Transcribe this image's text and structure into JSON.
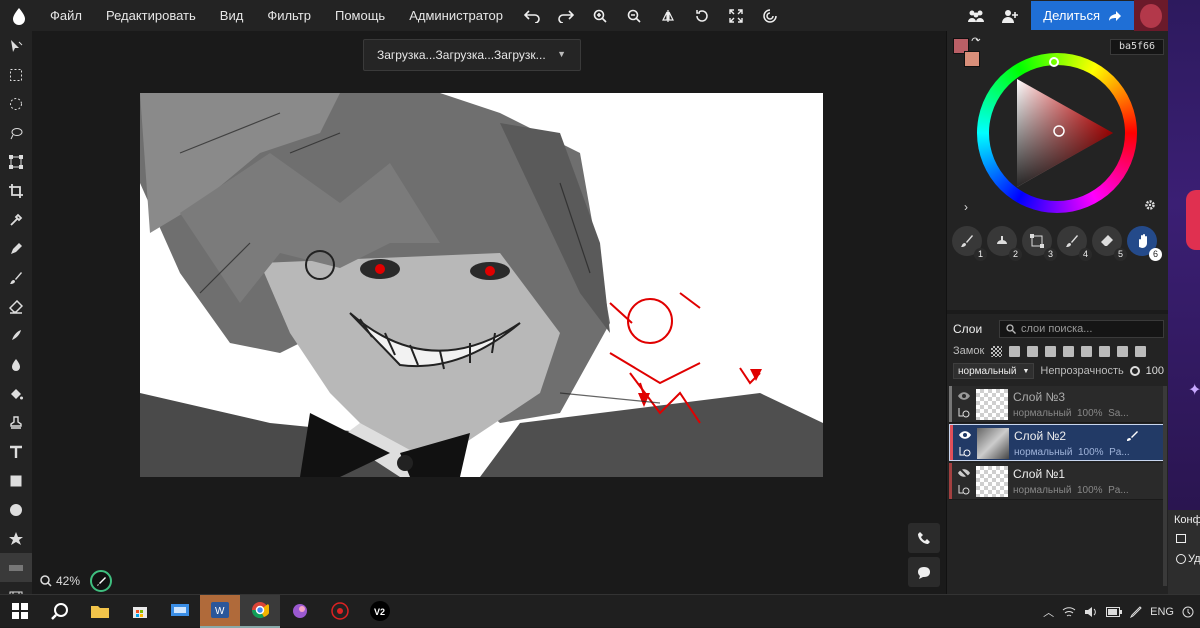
{
  "menu": {
    "items": [
      "Файл",
      "Редактировать",
      "Вид",
      "Фильтр",
      "Помощь",
      "Администратор"
    ],
    "toolbar_icons": [
      "undo-icon",
      "redo-icon",
      "zoom-in-icon",
      "zoom-out-icon",
      "flip-icon",
      "rotate-icon",
      "fullscreen-icon",
      "settings-swirl-icon"
    ],
    "share_label": "Делиться"
  },
  "document": {
    "title": "Загрузка...Загрузка...Загрузк..."
  },
  "workspace": {
    "zoom": "42%"
  },
  "color": {
    "hex": "ba5f66",
    "primary": "#ba5f66",
    "secondary": "#d98f7a"
  },
  "brushes": [
    "1",
    "2",
    "3",
    "4",
    "5",
    "6"
  ],
  "layers": {
    "title": "Слои",
    "search_placeholder": "слои поиска...",
    "lock_label": "Замок",
    "blend_mode": "нормальный",
    "opacity_label": "Непрозрачность",
    "opacity_value": "100",
    "items": [
      {
        "name": "Слой №3",
        "blend": "нормальный",
        "opacity": "100%",
        "extra": "Sa...",
        "selected": false
      },
      {
        "name": "Слой №2",
        "blend": "нормальный",
        "opacity": "100%",
        "extra": "Pa...",
        "selected": true
      },
      {
        "name": "Слой №1",
        "blend": "нормальный",
        "opacity": "100%",
        "extra": "Pa...",
        "selected": false
      }
    ]
  },
  "side_panel": {
    "texts": [
      "Конф",
      "Уд"
    ]
  },
  "taskbar": {
    "lang": "ENG"
  }
}
